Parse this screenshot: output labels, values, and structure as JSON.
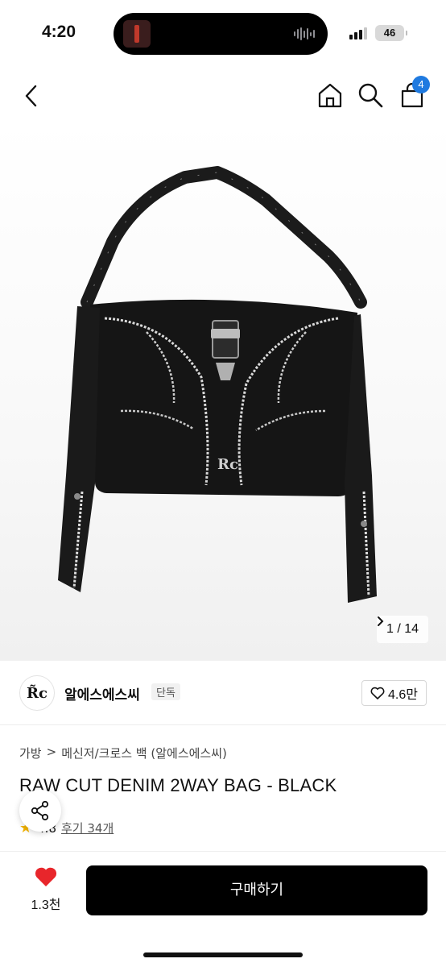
{
  "status_bar": {
    "time": "4:20",
    "battery": "46"
  },
  "nav": {
    "cart_count": "4"
  },
  "gallery": {
    "counter": "1 / 14",
    "next_icon": "chevron-right"
  },
  "brand": {
    "logo_text": "R̃c",
    "name": "알에스에스씨",
    "tag": "단독",
    "likes": "4.6만"
  },
  "breadcrumb": {
    "category": "가방",
    "separator": ">",
    "subcategory": "메신저/크로스 백 (알에스에스씨)"
  },
  "product": {
    "title": "RAW CUT DENIM 2WAY BAG - BLACK",
    "rating": "4.8",
    "reviews": "후기 34개"
  },
  "bottom_bar": {
    "wish_count": "1.3천",
    "buy_label": "구매하기"
  },
  "colors": {
    "accent": "#1f7ae0",
    "heart": "#e8262b",
    "buy_button": "#000000"
  }
}
